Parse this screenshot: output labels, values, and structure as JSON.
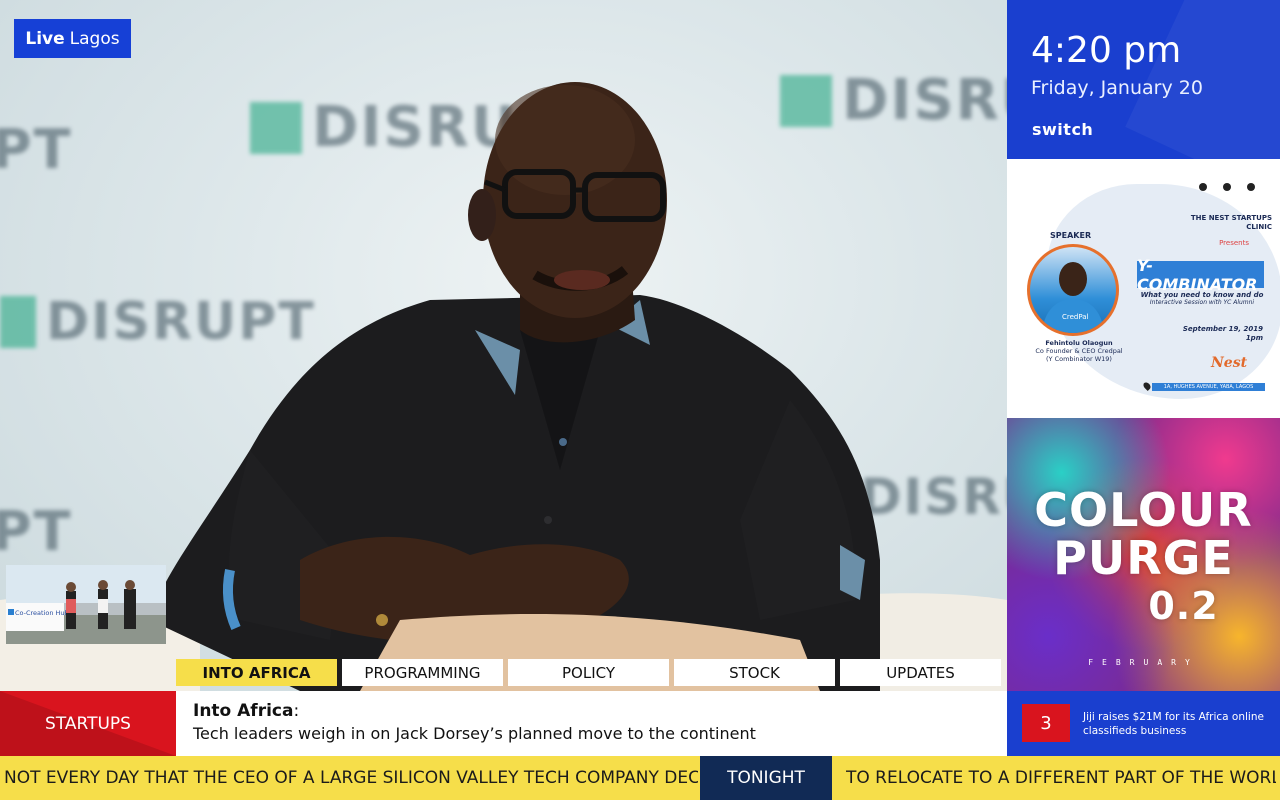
{
  "live_badge": {
    "bold": "Live",
    "location": "Lagos"
  },
  "background_signage": [
    "DISRUPT",
    "DISRUPT",
    "DISRUPT",
    "DISRUPT",
    "PT",
    "PT"
  ],
  "tabs": [
    {
      "label": "INTO AFRICA",
      "active": true
    },
    {
      "label": "PROGRAMMING",
      "active": false
    },
    {
      "label": "POLICY",
      "active": false
    },
    {
      "label": "STOCK",
      "active": false
    },
    {
      "label": "UPDATES",
      "active": false
    }
  ],
  "clock": {
    "time": "4:20 pm",
    "date": "Friday, January 20",
    "brand": "switch"
  },
  "poster": {
    "organizer": "THE NEST STARTUPS CLINIC",
    "presents": "Presents",
    "speaker_label": "SPEAKER",
    "title": "Y-COMBINATOR",
    "subtitle": "What you need to know and do",
    "subtitle2": "Interactive Session with YC Alumni",
    "date": "September 19, 2019",
    "time": "1pm",
    "speaker_name": "Fehintolu Olaogun",
    "speaker_role": "Co Founder & CEO Credpal",
    "speaker_note": "(Y Combinator W19)",
    "logo": "Nest",
    "address": "1A, HUGHES AVENUE, YABA, LAGOS",
    "shirt_logo": "CredPal"
  },
  "art": {
    "line1": "COLOUR",
    "line2": "PURGE",
    "line3": "0.2",
    "month": "FEBRUARY"
  },
  "pip": {
    "sign": "Co-Creation Hub"
  },
  "story": {
    "category": "STARTUPS",
    "headline": "Into Africa",
    "colon": ":",
    "subline": "Tech leaders weigh in on Jack Dorsey’s planned move to the continent"
  },
  "side_news": {
    "number": "3",
    "text": "Jiji raises $21M for its Africa online classifieds business"
  },
  "ticker": {
    "left": "NOT EVERY DAY THAT THE CEO OF A LARGE SILICON VALLEY TECH COMPANY DECIDES",
    "mid": "TONIGHT",
    "right": "TO RELOCATE TO A DIFFERENT PART OF THE WORLD"
  },
  "colors": {
    "brand_blue": "#1a3fcf",
    "accent_red": "#d9141e",
    "ticker_yellow": "#f6de4a",
    "ticker_navy": "#112a55"
  }
}
